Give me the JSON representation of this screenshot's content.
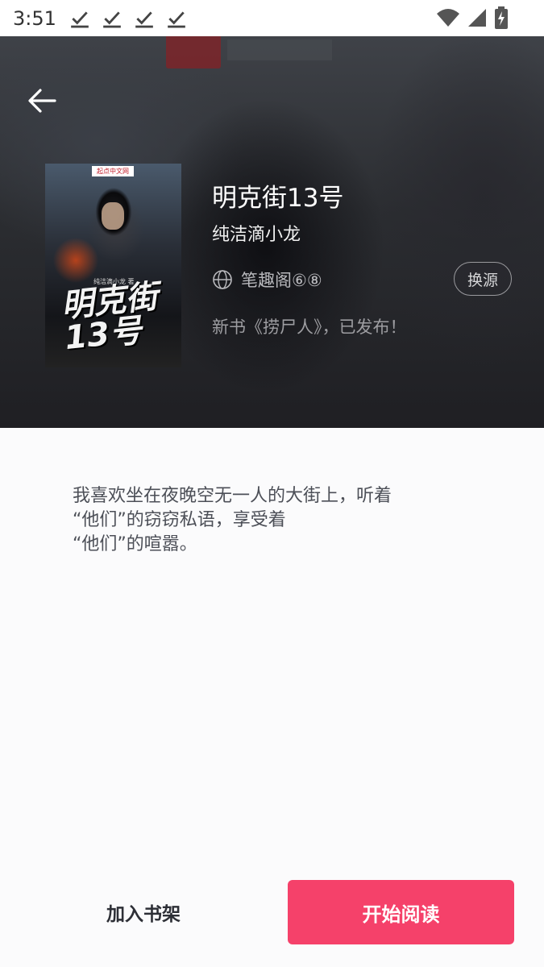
{
  "status_bar": {
    "time": "3:51",
    "download_icons": [
      "download-done-icon",
      "download-done-icon",
      "download-done-icon",
      "download-done-icon"
    ]
  },
  "book": {
    "title": "明克街13号",
    "author": "纯洁滴小龙",
    "source": "笔趣阁⑥⑧",
    "change_source_label": "换源",
    "latest_chapter": "新书《捞尸人》，已发布！",
    "cover": {
      "badge": "起点中文网",
      "title": "明克街13号",
      "author_line": "纯洁滴小龙 著"
    },
    "intro": "我喜欢坐在夜晚空无一人的大街上，听着\n“他们”的窃窃私语，享受着\n“他们”的喧嚣。"
  },
  "actions": {
    "add_to_shelf_label": "加入书架",
    "start_reading_label": "开始阅读"
  },
  "colors": {
    "accent": "#f5416a",
    "header_bg": "#2b2d31"
  }
}
